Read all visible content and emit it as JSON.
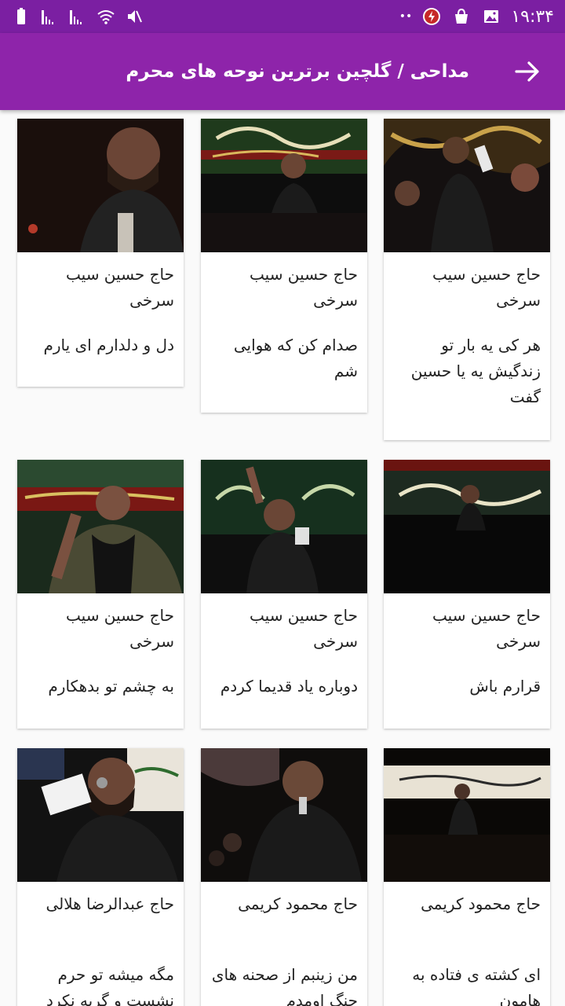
{
  "status": {
    "time": "۱۹:۳۴",
    "dots": "••"
  },
  "header": {
    "title": "مداحی / گلچین برترین نوحه های محرم"
  },
  "items": [
    {
      "artist": "حاج حسین سیب سرخی",
      "title": "هر کی یه بار تو زندگیش یه یا حسین گفت"
    },
    {
      "artist": "حاج حسین سیب سرخی",
      "title": "صدام کن که هوایی شم"
    },
    {
      "artist": "حاج حسین سیب سرخی",
      "title": "دل و دلدارم ای یارم"
    },
    {
      "artist": "حاج حسین سیب سرخی",
      "title": "قرارم باش"
    },
    {
      "artist": "حاج حسین سیب سرخی",
      "title": "دوباره یاد قدیما کردم"
    },
    {
      "artist": "حاج حسین سیب سرخی",
      "title": "به چشم تو بدهکارم"
    },
    {
      "artist": "حاج محمود کریمی",
      "title": "ای کشته ی فتاده به هامون"
    },
    {
      "artist": "حاج محمود کریمی",
      "title": "من زینبم از صحنه های جنگ اومدم"
    },
    {
      "artist": "حاج عبدالرضا هلالی",
      "title": "مگه میشه تو حرم نشست و گریه نکرد"
    }
  ],
  "colors": {
    "statusbar": "#7b1fa2",
    "appbar": "#8e24aa",
    "background": "#fafafa"
  }
}
